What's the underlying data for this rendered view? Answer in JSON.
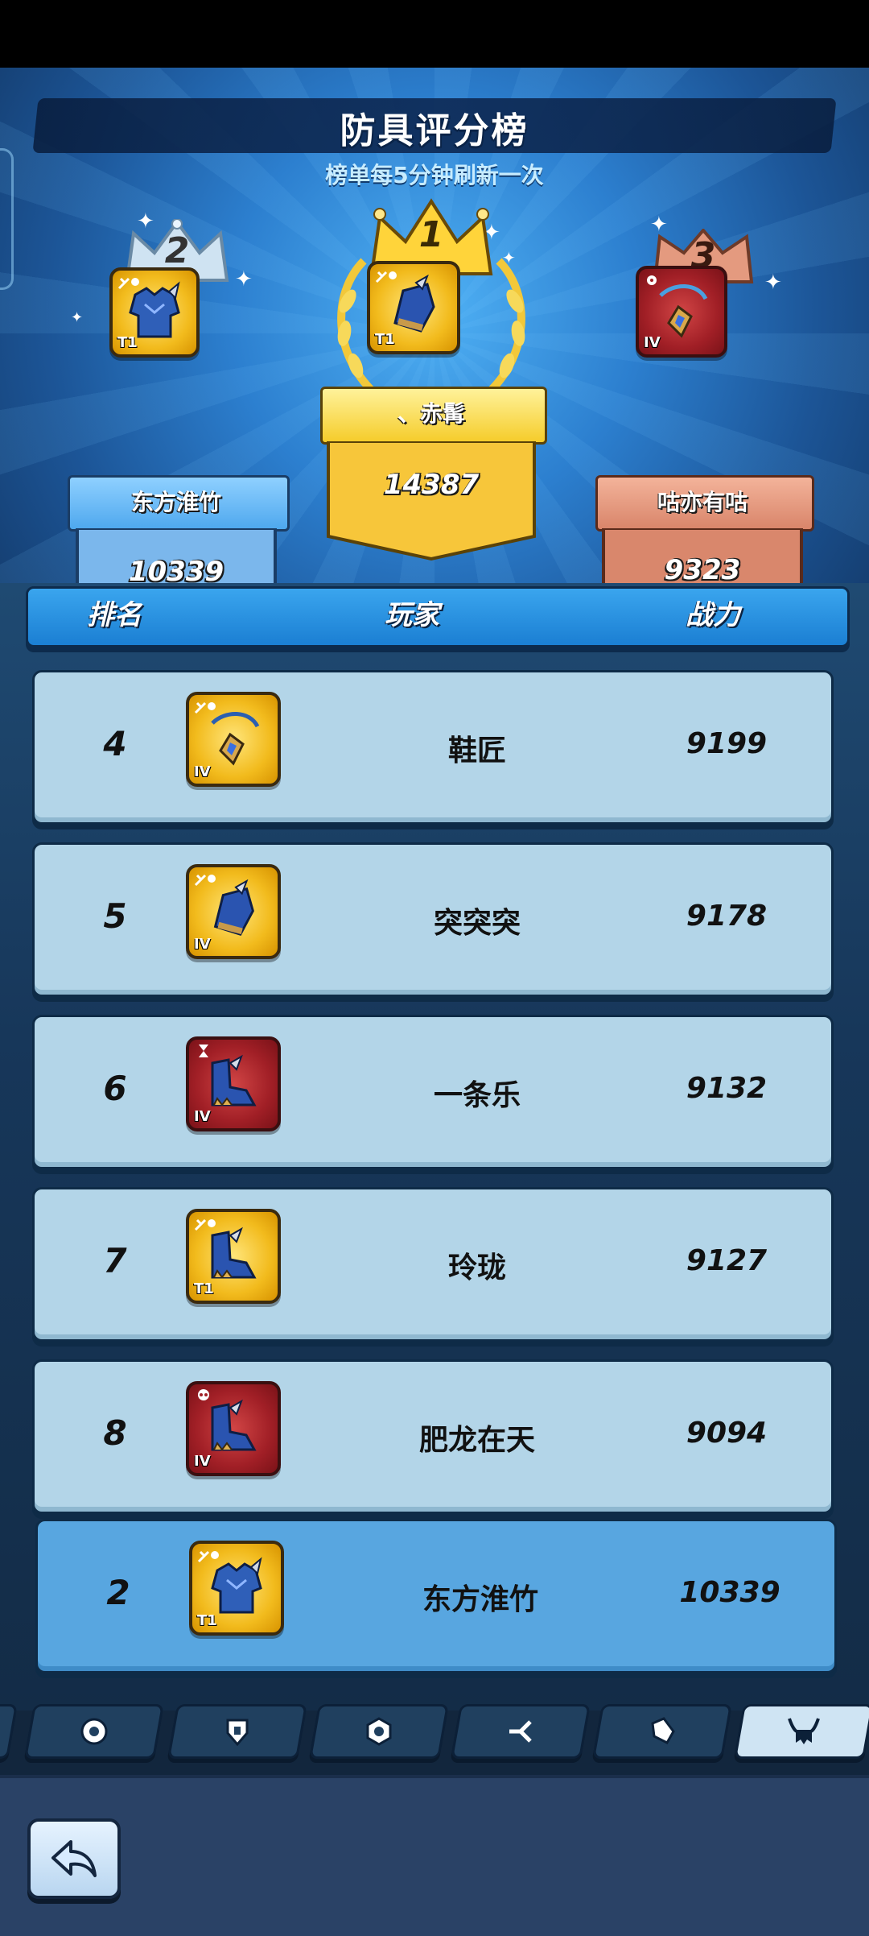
{
  "header": {
    "title": "防具评分榜",
    "subtitle": "榜单每5分钟刷新一次"
  },
  "podium": [
    {
      "rank": "2",
      "name": "东方淮竹",
      "score": "10339",
      "tier": "T1",
      "item_icon": "chest-armor-icon",
      "frame": "gold"
    },
    {
      "rank": "1",
      "name": "、赤髯",
      "score": "14387",
      "tier": "T1",
      "item_icon": "gauntlet-icon",
      "frame": "gold"
    },
    {
      "rank": "3",
      "name": "咕亦有咕",
      "score": "9323",
      "tier": "IV",
      "item_icon": "amulet-icon",
      "frame": "red"
    }
  ],
  "table": {
    "columns": [
      "排名",
      "玩家",
      "战力"
    ],
    "rows": [
      {
        "rank": "4",
        "name": "鞋匠",
        "power": "9199",
        "tier": "IV",
        "item_icon": "amulet-icon",
        "frame": "gold"
      },
      {
        "rank": "5",
        "name": "突突突",
        "power": "9178",
        "tier": "IV",
        "item_icon": "gauntlet-icon",
        "frame": "gold"
      },
      {
        "rank": "6",
        "name": "一条乐",
        "power": "9132",
        "tier": "IV",
        "item_icon": "boots-icon",
        "frame": "red"
      },
      {
        "rank": "7",
        "name": "玲珑",
        "power": "9127",
        "tier": "T1",
        "item_icon": "boots-icon",
        "frame": "gold"
      },
      {
        "rank": "8",
        "name": "肥龙在天",
        "power": "9094",
        "tier": "IV",
        "item_icon": "boots-icon",
        "frame": "red"
      }
    ],
    "my_row": {
      "rank": "2",
      "name": "东方淮竹",
      "power": "10339",
      "tier": "T1",
      "item_icon": "chest-armor-icon",
      "frame": "gold"
    }
  },
  "tabs": [
    {
      "icon": "orb-icon",
      "active": false
    },
    {
      "icon": "shield-hand-icon",
      "active": false
    },
    {
      "icon": "emblem-icon",
      "active": false
    },
    {
      "icon": "split-arrow-icon",
      "active": false
    },
    {
      "icon": "glove-icon",
      "active": false
    },
    {
      "icon": "horned-helmet-icon",
      "active": true
    }
  ],
  "colors": {
    "gold_frame": "#f2bb1d",
    "red_frame": "#a11f26",
    "header_blue": "#1b7fd3",
    "row_bg": "#b3d5e8",
    "my_row_bg": "#58a6e0"
  }
}
